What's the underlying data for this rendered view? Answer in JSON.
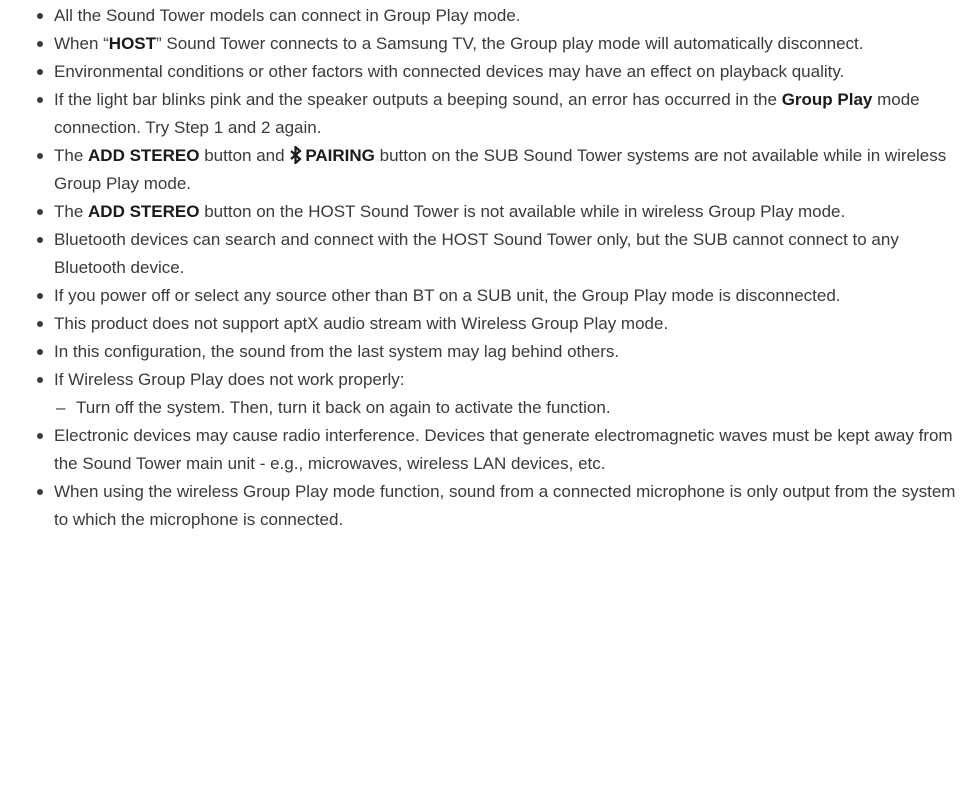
{
  "notes": [
    {
      "text": "All the Sound Tower models can connect in Group Play mode."
    },
    {
      "pre": "When “",
      "bold": "HOST",
      "post": "” Sound Tower connects to a Samsung TV, the Group play mode will automatically disconnect."
    },
    {
      "text": "Environmental conditions or other factors with connected devices may have an effect on playback quality."
    },
    {
      "pre": "If the light bar blinks pink and the speaker outputs a beeping sound, an error has occurred in the ",
      "bold": "Group Play",
      "post": " mode connection. Try Step 1 and 2 again."
    },
    {
      "pre": "The ",
      "bold": "ADD STEREO",
      "mid": " button and ",
      "icon": "bluetooth-icon",
      "bold2": "PAIRING",
      "post": " button on the SUB Sound Tower systems are not available while in wireless Group Play mode."
    },
    {
      "pre": "The ",
      "bold": "ADD STEREO",
      "post": " button on the HOST Sound Tower is not available while in wireless Group Play mode."
    },
    {
      "text": "Bluetooth devices can search and connect with the HOST Sound Tower only, but the SUB cannot connect to any Bluetooth device."
    },
    {
      "text": "If you power off or select any source other than BT on a SUB unit, the Group Play mode is disconnected."
    },
    {
      "text": "This product does not support aptX audio stream with Wireless Group Play mode."
    },
    {
      "text": "In this configuration, the sound from the last system may lag behind others."
    },
    {
      "text": "If Wireless Group Play does not work properly:",
      "sub": [
        "Turn off the system. Then, turn it back on again to activate the function."
      ]
    },
    {
      "text": "Electronic devices may cause radio interference. Devices that generate electromagnetic waves must be kept away from the Sound Tower main unit - e.g., microwaves, wireless LAN devices, etc."
    },
    {
      "text": "When using the wireless Group Play mode function, sound from a connected microphone is only output from the system to which the microphone is connected."
    }
  ]
}
